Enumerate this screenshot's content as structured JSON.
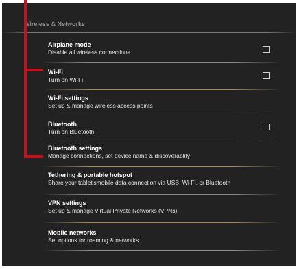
{
  "section": {
    "title": "Wireless & Networks"
  },
  "items": [
    {
      "title": "Airplane mode",
      "subtitle": "Disable all wireless connections",
      "has_checkbox": true,
      "checked": false
    },
    {
      "title": "Wi-Fi",
      "subtitle": "Turn on Wi-Fi",
      "has_checkbox": true,
      "checked": false
    },
    {
      "title": "Wi-Fi settings",
      "subtitle": "Set up & manage wireless access points",
      "has_checkbox": false
    },
    {
      "title": "Bluetooth",
      "subtitle": "Turn on Bluetooth",
      "has_checkbox": true,
      "checked": false
    },
    {
      "title": "Bluetooth settings",
      "subtitle": "Manage connections, set device name & discoverablity",
      "has_checkbox": false
    },
    {
      "title": "Tethering  & portable hotspot",
      "subtitle": "Share your tablet'smobile data connection via USB, Wi-Fi, or Bluetooth",
      "has_checkbox": false
    },
    {
      "title": "VPN settings",
      "subtitle": "Set up & manage Virtual Private Networks (VPNs)",
      "has_checkbox": false
    },
    {
      "title": "Mobile networks",
      "subtitle": "Set options for roaming & networks",
      "has_checkbox": false
    }
  ],
  "colors": {
    "background": "#222222",
    "annotation": "#c8101c",
    "divider": "#afa078",
    "header_line": "#6ea0d2"
  }
}
